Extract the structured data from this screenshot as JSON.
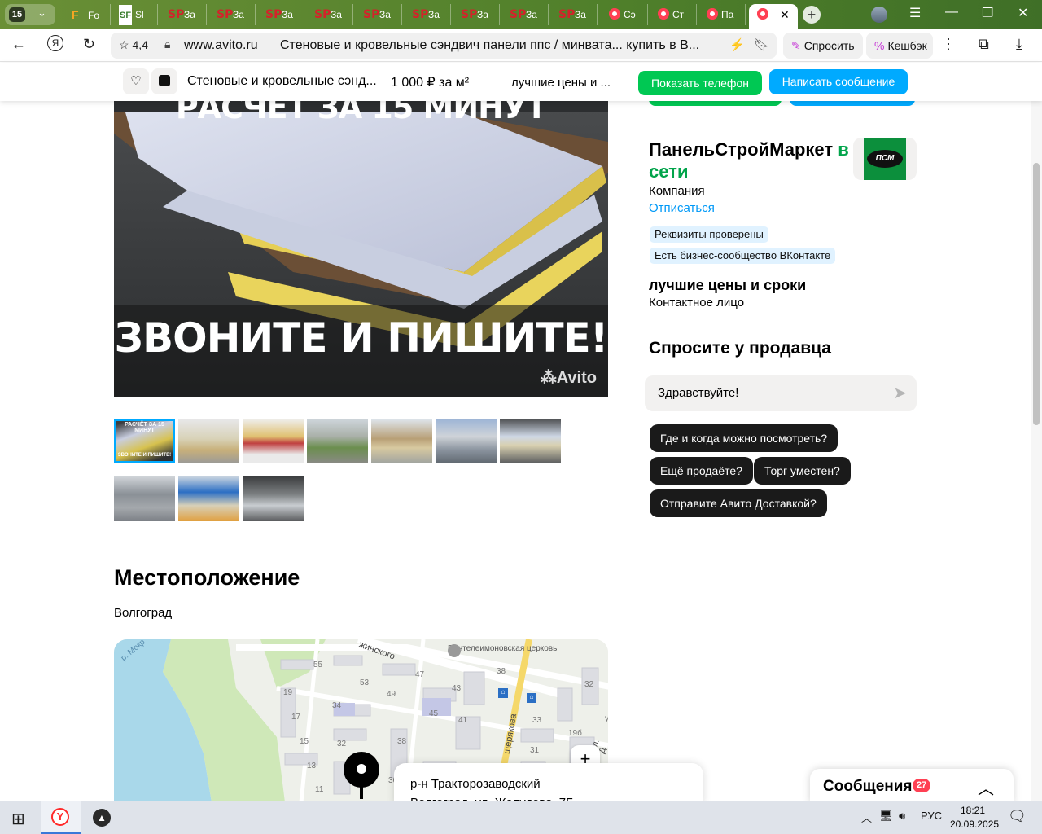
{
  "browser": {
    "tab_count": "15",
    "tabs": [
      {
        "fav": "F",
        "label": "Fo"
      },
      {
        "fav": "SF",
        "label": "Sl"
      },
      {
        "fav": "SP",
        "label": "За"
      },
      {
        "fav": "SP",
        "label": "За"
      },
      {
        "fav": "SP",
        "label": "За"
      },
      {
        "fav": "SP",
        "label": "За"
      },
      {
        "fav": "SP",
        "label": "За"
      },
      {
        "fav": "SP",
        "label": "За"
      },
      {
        "fav": "SP",
        "label": "За"
      },
      {
        "fav": "SP",
        "label": "За"
      },
      {
        "fav": "SP",
        "label": "За"
      },
      {
        "fav": "",
        "label": "Сэ"
      },
      {
        "fav": "",
        "label": "Ст"
      },
      {
        "fav": "",
        "label": "Па"
      }
    ],
    "rating": "4,4",
    "url": "www.avito.ru",
    "page_title": "Стеновые и кровельные сэндвич панели ппс / минвата... купить в В...",
    "ask_label": "Спросить",
    "cashback_label": "Кешбэк"
  },
  "sticky": {
    "title": "Стеновые и кровельные сэнд...",
    "price": "1 000 ₽ за м²",
    "seller": "лучшие цены и ...",
    "show_phone": "Показать телефон",
    "write_message": "Написать сообщение"
  },
  "photo": {
    "top_text": "РАСЧЁТ ЗА 15 МИНУТ",
    "bottom_text": "ЗВОНИТЕ И ПИШИТЕ!",
    "watermark": "Avito",
    "thumb_top": "РАСЧЁТ ЗА 15 МИНУТ",
    "thumb_bottom": "ЗВОНИТЕ И ПИШИТЕ!"
  },
  "seller": {
    "name": "ПанельСтройМаркет",
    "online": "в сети",
    "type": "Компания",
    "unsubscribe": "Отписаться",
    "badge_1": "Реквизиты проверены",
    "badge_2": "Есть бизнес-сообщество ВКонтакте",
    "contact_name": "лучшие цены и сроки",
    "contact_role": "Контактное лицо"
  },
  "ask": {
    "heading": "Спросите у продавца",
    "input_value": "Здравствуйте!",
    "chips": [
      "Где и когда можно посмотреть?",
      "Ещё продаёте?",
      "Торг уместен?",
      "Отправите Авито Доставкой?"
    ]
  },
  "location": {
    "heading": "Местоположение",
    "city": "Волгоград",
    "district": "р-н Тракторозаводский",
    "address": "Волгоград, ул. Жолудева, 7Б",
    "map_labels": {
      "river": "р. Мокр",
      "street_1": "жинского",
      "church": "Пантелеимоновская церковь",
      "street_2": "щерякова",
      "street_3": "ул. Д",
      "numbers": [
        "55",
        "47",
        "38",
        "32",
        "53",
        "43",
        "49",
        "19",
        "34",
        "45",
        "41",
        "33",
        "17",
        "19б",
        "15",
        "32",
        "38",
        "31",
        "13",
        "11",
        "36",
        "у"
      ]
    }
  },
  "messages": {
    "label": "Сообщения",
    "count": "27"
  },
  "taskbar": {
    "lang": "РУС",
    "time": "18:21",
    "date": "20.09.2025"
  },
  "colors": {
    "green": "#00c853",
    "blue": "#00aaff",
    "online": "#02a44b",
    "chip": "#1a1a1a",
    "badge": "#e0f2ff"
  }
}
